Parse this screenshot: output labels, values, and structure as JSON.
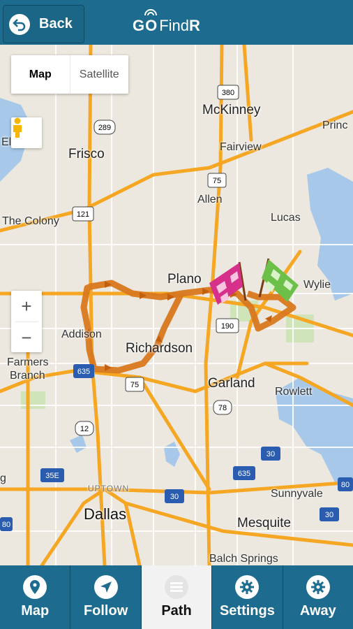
{
  "header": {
    "back_label": "Back",
    "logo_go": "GO",
    "logo_find": "Find",
    "logo_r": "R"
  },
  "map": {
    "type_options": [
      {
        "label": "Map",
        "active": true
      },
      {
        "label": "Satellite",
        "active": false
      }
    ],
    "zoom_in": "+",
    "zoom_out": "−",
    "places": {
      "mckinney": "McKinney",
      "princeton": "Princ",
      "frisco": "Frisco",
      "fairview": "Fairview",
      "allen": "Allen",
      "lucas": "Lucas",
      "the_colony": "The Colony",
      "plano": "Plano",
      "wylie": "Wylie",
      "addison": "Addison",
      "richardson": "Richardson",
      "farmers": "Farmers",
      "branch": "Branch",
      "garland": "Garland",
      "rowlett": "Rowlett",
      "uptown": "UPTOWN",
      "sunnyvale": "Sunnyvale",
      "dallas": "Dallas",
      "mesquite": "Mesquite",
      "balch_springs": "Balch Springs",
      "edge_el": "El",
      "edge_g": "g"
    },
    "shields": {
      "s380": "380",
      "s289": "289",
      "s75a": "75",
      "s121": "121",
      "s190": "190",
      "s635a": "635",
      "s75b": "75",
      "s78": "78",
      "s12": "12",
      "s30a": "30",
      "s35e": "35E",
      "s635b": "635",
      "s30b": "30",
      "s30c": "30",
      "s80a": "80",
      "s80b": "80"
    },
    "colors": {
      "track": "#d9781e",
      "road": "#f5a623",
      "water": "#a7c8e9",
      "start_flag": "#d6308a",
      "end_flag": "#6cc04a"
    }
  },
  "nav": {
    "tabs": [
      {
        "label": "Map",
        "icon": "map-pin-icon",
        "active": false
      },
      {
        "label": "Follow",
        "icon": "navigation-arrow-icon",
        "active": false
      },
      {
        "label": "Path",
        "icon": "path-lines-icon",
        "active": true
      },
      {
        "label": "Settings",
        "icon": "gear-icon",
        "active": false
      },
      {
        "label": "Away",
        "icon": "gear-icon",
        "active": false
      }
    ]
  }
}
